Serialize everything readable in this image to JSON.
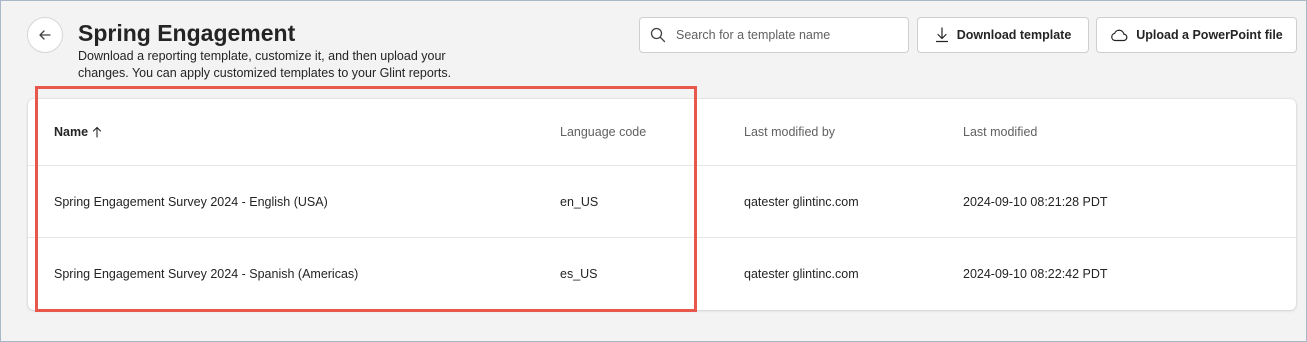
{
  "page": {
    "title": "Spring Engagement",
    "subtitle": "Download a reporting template, customize it, and then upload your changes. You can apply customized templates to your Glint reports."
  },
  "toolbar": {
    "search_placeholder": "Search for a template name",
    "download_label": "Download template",
    "upload_label": "Upload a PowerPoint file"
  },
  "table": {
    "columns": {
      "name": "Name",
      "language": "Language code",
      "modified_by": "Last modified by",
      "modified": "Last modified"
    },
    "sort": {
      "column": "name",
      "direction": "ascending"
    },
    "rows": [
      {
        "name": "Spring Engagement Survey 2024 - English (USA)",
        "language": "en_US",
        "modified_by": "qatester glintinc.com",
        "modified": "2024-09-10 08:21:28 PDT"
      },
      {
        "name": "Spring Engagement Survey 2024 - Spanish (Americas)",
        "language": "es_US",
        "modified_by": "qatester glintinc.com",
        "modified": "2024-09-10 08:22:42 PDT"
      }
    ]
  },
  "icons": {
    "back": "arrow-left-icon",
    "search": "search-icon",
    "download": "download-icon",
    "upload": "cloud-upload-icon",
    "sort": "arrow-up-icon"
  },
  "colors": {
    "highlight_border": "#e8574b",
    "page_background": "#f3f3f3",
    "card_background": "#ffffff"
  }
}
